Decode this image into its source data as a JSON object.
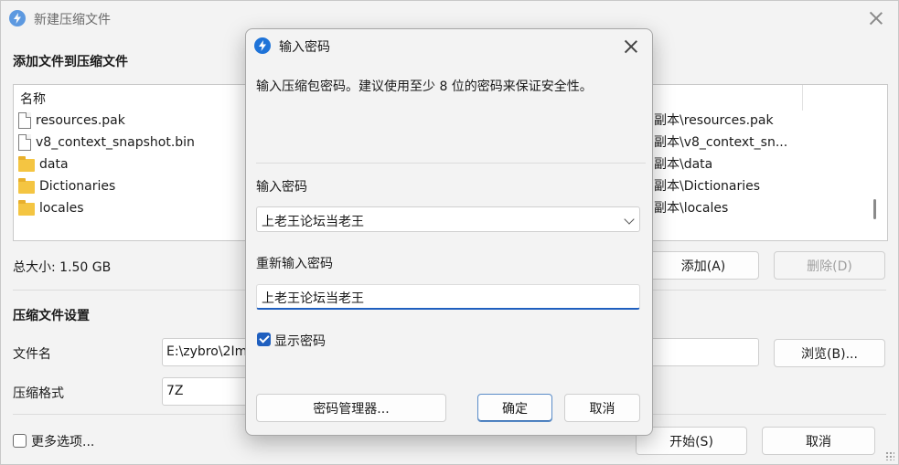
{
  "main_window": {
    "title": "新建压缩文件",
    "add_section_title": "添加文件到压缩文件",
    "file_list": {
      "column_name": "名称",
      "items": [
        {
          "name": "resources.pak",
          "type": "file",
          "path": "副本\\resources.pak"
        },
        {
          "name": "v8_context_snapshot.bin",
          "type": "file",
          "path": "副本\\v8_context_sn..."
        },
        {
          "name": "data",
          "type": "folder",
          "path": "副本\\data"
        },
        {
          "name": "Dictionaries",
          "type": "folder",
          "path": "副本\\Dictionaries"
        },
        {
          "name": "locales",
          "type": "folder",
          "path": "副本\\locales"
        }
      ]
    },
    "total_size": "总大小: 1.50 GB",
    "add_button": "添加(A)",
    "remove_button": "删除(D)",
    "settings_section_title": "压缩文件设置",
    "filename_label": "文件名",
    "filename_value": "E:\\zybro\\2Im",
    "browse_button": "浏览(B)...",
    "format_label": "压缩格式",
    "format_value": "7Z",
    "more_options_label": "更多选项...",
    "start_button": "开始(S)",
    "cancel_button": "取消"
  },
  "password_dialog": {
    "title": "输入密码",
    "hint": "输入压缩包密码。建议使用至少 8 位的密码来保证安全性。",
    "password_label": "输入密码",
    "password_value": "上老王论坛当老王",
    "reenter_label": "重新输入密码",
    "reenter_value": "上老王论坛当老王",
    "show_password_label": "显示密码",
    "show_password_checked": true,
    "manager_button": "密码管理器...",
    "ok_button": "确定",
    "cancel_button": "取消"
  },
  "colors": {
    "accent": "#1f5fbf",
    "folder": "#f4c542",
    "window_bg": "#f3f3f3"
  }
}
